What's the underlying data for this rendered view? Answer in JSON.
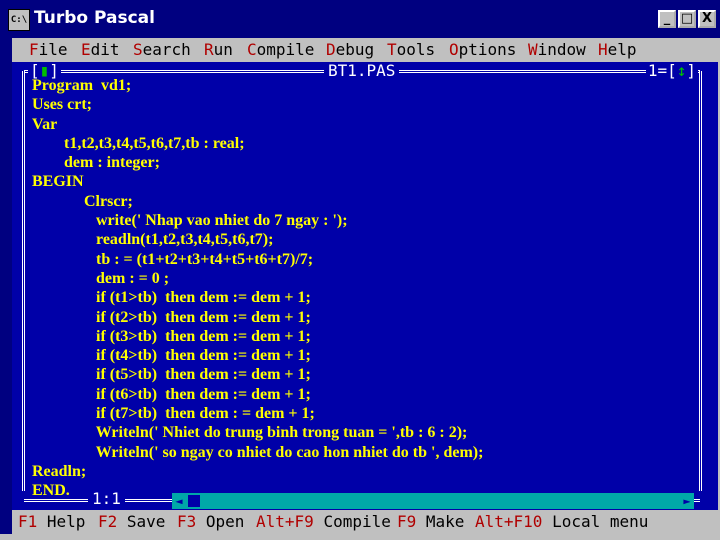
{
  "window": {
    "title": "Turbo Pascal",
    "system_icon": "C:\\",
    "buttons": {
      "minimize": "_",
      "maximize": "□",
      "close": "X"
    }
  },
  "menu": [
    {
      "hot": "F",
      "rest": "ile"
    },
    {
      "hot": "E",
      "rest": "dit"
    },
    {
      "hot": "S",
      "rest": "earch"
    },
    {
      "hot": "R",
      "rest": "un"
    },
    {
      "hot": "C",
      "rest": "ompile"
    },
    {
      "hot": "D",
      "rest": "ebug"
    },
    {
      "hot": "T",
      "rest": "ools"
    },
    {
      "hot": "O",
      "rest": "ptions"
    },
    {
      "hot": "W",
      "rest": "indow"
    },
    {
      "hot": "H",
      "rest": "elp"
    }
  ],
  "editor": {
    "close_box": {
      "left": "[",
      "mark": "▮",
      "right": "]"
    },
    "file_name": "BT1.PAS",
    "window_number": {
      "prefix": "1=[",
      "mark": "↕",
      "suffix": "]"
    },
    "cursor_position": "1:1",
    "code_lines": [
      "Program  vd1;",
      "Uses crt;",
      "Var",
      "        t1,t2,t3,t4,t5,t6,t7,tb : real;",
      "        dem : integer;",
      "BEGIN",
      "             Clrscr;",
      "                write(' Nhap vao nhiet do 7 ngay : ');",
      "                readln(t1,t2,t3,t4,t5,t6,t7);",
      "                tb : = (t1+t2+t3+t4+t5+t6+t7)/7;",
      "                dem : = 0 ;",
      "                if (t1>tb)  then dem := dem + 1;",
      "                if (t2>tb)  then dem := dem + 1;",
      "                if (t3>tb)  then dem := dem + 1;",
      "                if (t4>tb)  then dem := dem + 1;",
      "                if (t5>tb)  then dem := dem + 1;",
      "                if (t6>tb)  then dem := dem + 1;",
      "                if (t7>tb)  then dem : = dem + 1;",
      "                Writeln(' Nhiet do trung binh trong tuan = ',tb : 6 : 2);",
      "                Writeln(' so ngay co nhiet do cao hon nhiet do tb ', dem);",
      "Readln;",
      "END."
    ]
  },
  "status_bar": [
    {
      "key": "F1",
      "label": "Help"
    },
    {
      "key": "F2",
      "label": "Save"
    },
    {
      "key": "F3",
      "label": "Open"
    },
    {
      "key": "Alt+F9",
      "label": "Compile"
    },
    {
      "key": "F9",
      "label": "Make"
    },
    {
      "key": "Alt+F10",
      "label": "Local menu"
    }
  ],
  "colors": {
    "title_bar": "#000080",
    "editor_bg": "#0000a8",
    "code_text": "#ffff00",
    "hotkey": "#b00000",
    "chrome": "#c0c0c0"
  }
}
